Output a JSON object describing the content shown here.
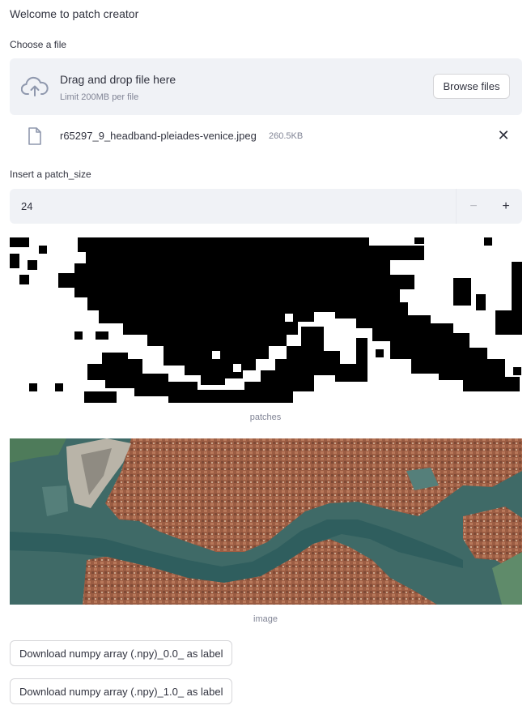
{
  "title": "Welcome to patch creator",
  "uploader": {
    "label": "Choose a file",
    "drop_title": "Drag and drop file here",
    "drop_limit": "Limit 200MB per file",
    "browse_label": "Browse files",
    "upload_icon": "cloud-upload-icon"
  },
  "file": {
    "name": "r65297_9_headband-pleiades-venice.jpeg",
    "size": "260.5KB",
    "icon": "file-icon",
    "remove_glyph": "✕"
  },
  "patch_size": {
    "label": "Insert a patch_size",
    "value": "24",
    "minus_glyph": "−",
    "plus_glyph": "+"
  },
  "patches": {
    "caption": "patches"
  },
  "image": {
    "caption": "image"
  },
  "downloads": [
    {
      "label": "Download numpy array (.npy)_0.0_ as label"
    },
    {
      "label": "Download numpy array (.npy)_1.0_ as label"
    }
  ]
}
